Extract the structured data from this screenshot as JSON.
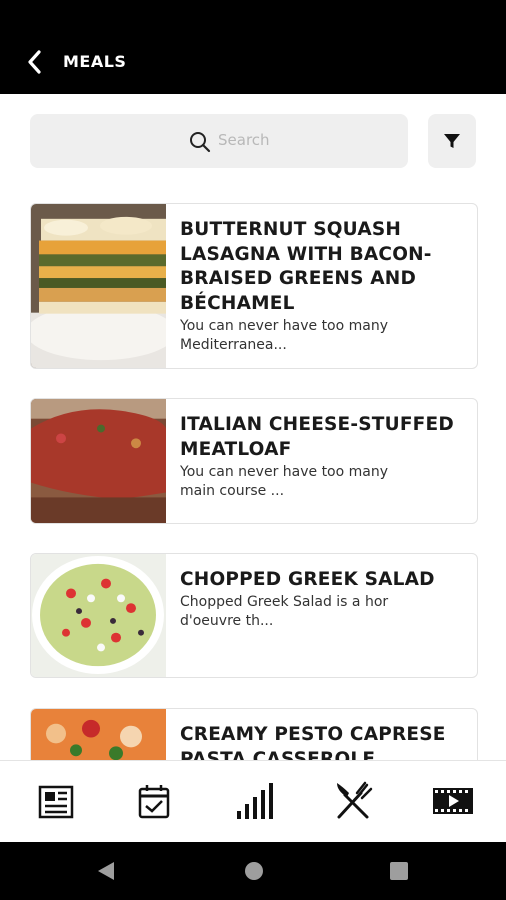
{
  "header": {
    "title": "MEALS"
  },
  "search": {
    "placeholder": "Search"
  },
  "meals": [
    {
      "title_lines": [
        "BUTTERNUT SQUASH",
        "LASAGNA WITH BACON-",
        "BRAISED GREENS AND",
        "BÉCHAMEL"
      ],
      "desc_lines": [
        "You can never have too many",
        "Mediterranea..."
      ]
    },
    {
      "title_lines": [
        "ITALIAN CHEESE-STUFFED",
        "MEATLOAF"
      ],
      "desc_lines": [
        "You can never have too many",
        "main course ..."
      ]
    },
    {
      "title_lines": [
        "CHOPPED GREEK SALAD"
      ],
      "desc_lines": [
        "Chopped Greek Salad is a hor",
        "d'oeuvre th..."
      ]
    },
    {
      "title_lines": [
        "CREAMY PESTO CAPRESE",
        "PASTA CASSEROLE"
      ],
      "desc_lines": []
    }
  ],
  "bottom_nav": [
    "news-icon",
    "calendar-check-icon",
    "bar-chart-icon",
    "fork-knife-icon",
    "video-icon"
  ],
  "system_nav": [
    "back-triangle-icon",
    "home-circle-icon",
    "recents-square-icon"
  ]
}
